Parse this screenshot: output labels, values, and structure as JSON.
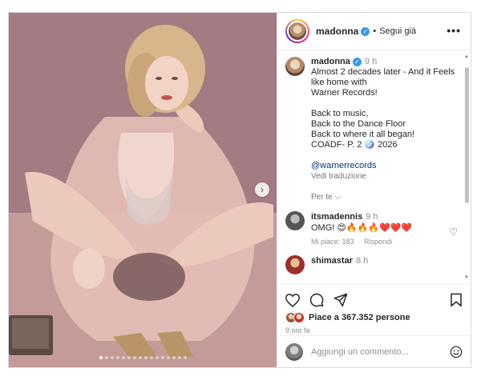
{
  "post": {
    "username": "madonna",
    "follow_label": "Segui già",
    "more_label": "•••"
  },
  "caption": {
    "username": "madonna",
    "time": "9 h",
    "lines": [
      "Almost 2 decades later - And it Feels",
      "like  home with",
      "Warner Records!",
      "",
      "Back to music,",
      "Back to the Dance Floor",
      "Back to where it all began!",
      "COADF- P. 2 🪩 2026"
    ],
    "mention": "@warnerrecords",
    "translate": "Vedi traduzione"
  },
  "for_you_label": "Per te",
  "comments": [
    {
      "username": "itsmadennis",
      "time": "9 h",
      "text": "OMG! 😍🔥🔥🔥❤️❤️❤️",
      "likes": "Mi piace: 183",
      "reply": "Rispondi"
    },
    {
      "username": "shimastar",
      "time": "8 h"
    }
  ],
  "likes_text": "Piace a 367.352 persone",
  "time_ago": "9 ore fa",
  "comment_placeholder": "Aggiungi un commento...",
  "carousel": {
    "slide_count": 16,
    "active_index": 0
  },
  "icons": {
    "like": "heart-icon",
    "comment": "comment-icon",
    "share": "share-icon",
    "save": "bookmark-icon",
    "emoji": "emoji-icon",
    "next": "chevron-right-icon"
  }
}
